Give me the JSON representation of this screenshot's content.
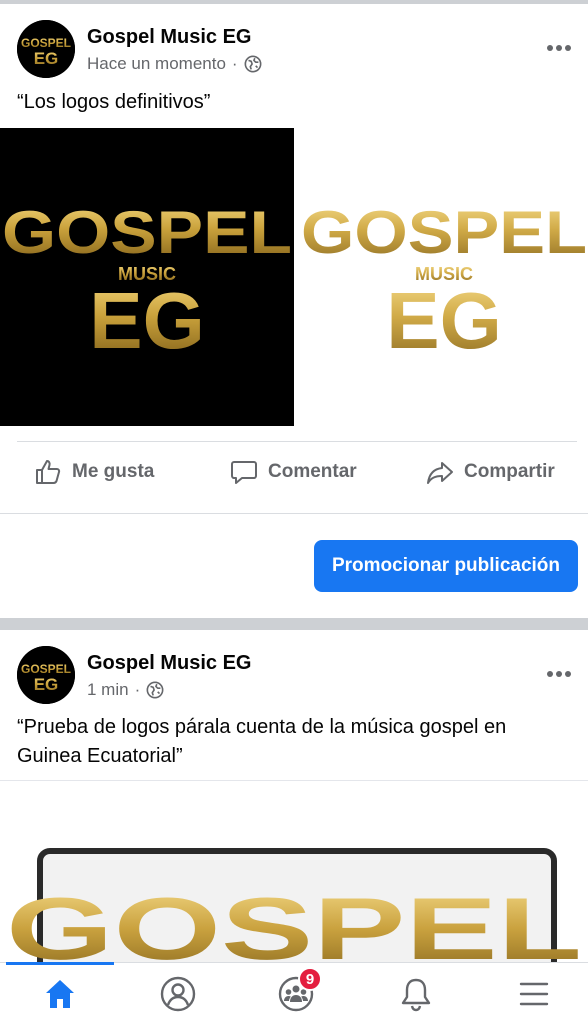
{
  "colors": {
    "accent": "#1877f2",
    "text_primary": "#050505",
    "text_secondary": "#65676b",
    "badge": "#e41e3f",
    "logo_gold": "#c9a13b",
    "separator": "#cdd0d4"
  },
  "posts": [
    {
      "page_name": "Gospel Music EG",
      "time": "Hace un momento",
      "privacy_icon": "globe-icon",
      "caption": "“Los logos definitivos”",
      "images": [
        {
          "desc_icon": "gospel-logo-black-bg",
          "logo": {
            "line1": "GOSPEL",
            "line2": "MUSIC",
            "line3": "EG"
          }
        },
        {
          "desc_icon": "gospel-logo-white-bg",
          "logo": {
            "line1": "GOSPEL",
            "line2": "MUSIC",
            "line3": "EG"
          }
        }
      ],
      "actions": [
        {
          "label": "Me gusta",
          "icon": "thumbs-up-icon"
        },
        {
          "label": "Comentar",
          "icon": "comment-icon"
        },
        {
          "label": "Compartir",
          "icon": "share-icon"
        }
      ],
      "promote_label": "Promocionar publicación"
    },
    {
      "page_name": "Gospel Music EG",
      "time": "1 min",
      "privacy_icon": "globe-icon",
      "caption": "“Prueba de logos párala cuenta de la música gospel en Guinea Ecuatorial”",
      "images": [
        {
          "desc_icon": "gospel-logo-laptop",
          "logo": {
            "line1": "GOSPEL"
          }
        }
      ]
    }
  ],
  "avatar_logo": {
    "line1": "GOSPEL",
    "line2": "EG"
  },
  "tabbar": {
    "tabs": [
      {
        "name": "home",
        "icon": "home-icon",
        "active": true
      },
      {
        "name": "profile",
        "icon": "profile-icon",
        "active": false
      },
      {
        "name": "groups",
        "icon": "groups-icon",
        "active": false,
        "badge": "9"
      },
      {
        "name": "notifications",
        "icon": "bell-icon",
        "active": false
      },
      {
        "name": "menu",
        "icon": "menu-icon",
        "active": false
      }
    ]
  }
}
